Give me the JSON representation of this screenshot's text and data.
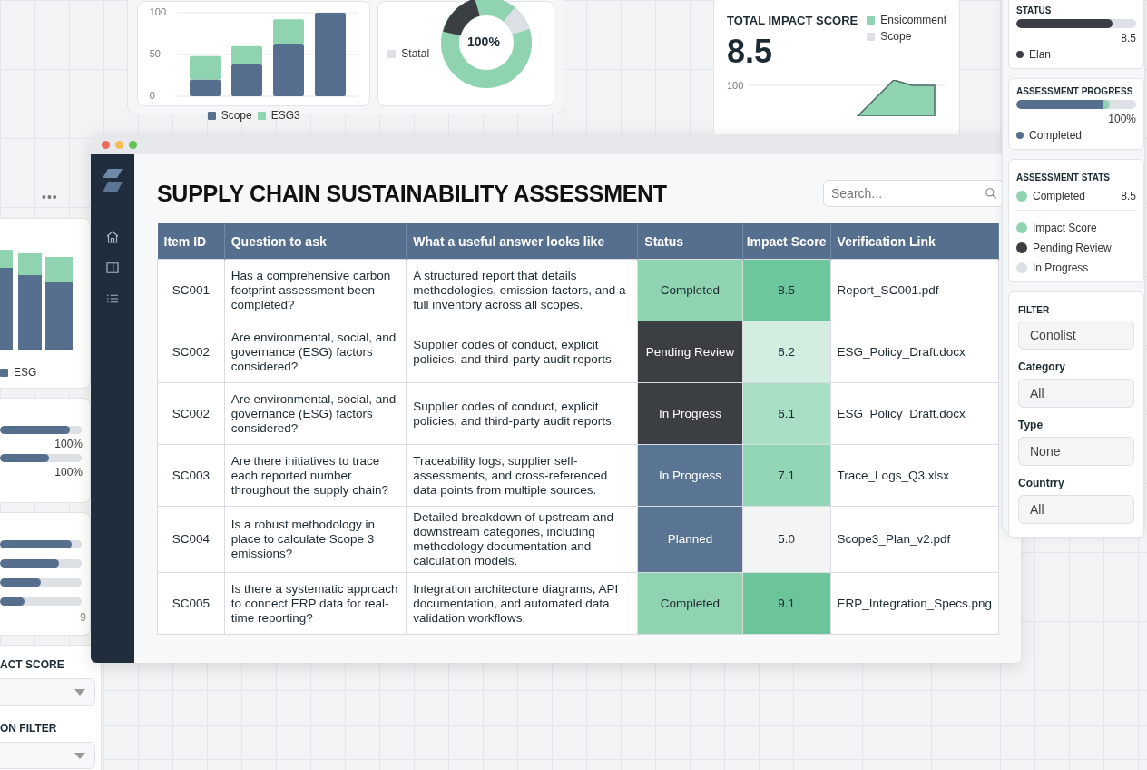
{
  "background": {
    "top_chart_card": {
      "chart_data": {
        "type": "bar",
        "stacked": true,
        "yticks": [
          0,
          50,
          100
        ],
        "ylim": [
          0,
          100
        ],
        "series": [
          {
            "name": "Scope",
            "color": "#566f8f",
            "values": [
              20,
              38,
              62,
              100
            ]
          },
          {
            "name": "ESG3",
            "color": "#8fd3b0",
            "values": [
              28,
              22,
              30,
              0
            ]
          }
        ]
      }
    },
    "donut_card": {
      "center_label": "100%",
      "legend": [
        {
          "label": "Statal",
          "color": "#dcdfe3"
        }
      ]
    },
    "impact_card": {
      "title": "TOTAL IMPACT SCORE",
      "value": "8.5",
      "axis_label": "100",
      "legend": [
        {
          "label": "Ensicomment",
          "color": "#8fd3b0"
        },
        {
          "label": "Scope",
          "color": "#dde1e6"
        }
      ]
    },
    "left_panel": {
      "menu": "•••",
      "chart_legend": "ESG",
      "progress": [
        {
          "level": 0.85,
          "reading": "100%"
        },
        {
          "level": 0.6,
          "reading": "100%"
        }
      ],
      "bars": [
        {
          "level": 0.88
        },
        {
          "level": 0.72
        },
        {
          "level": 0.5
        },
        {
          "level": 0.3
        }
      ],
      "bars_note": "9",
      "dropdowns": [
        {
          "label": "ACT SCORE"
        },
        {
          "label": "ON FILTER"
        }
      ]
    },
    "right_panel": {
      "status": {
        "title": "STATUS",
        "level": 0.8,
        "reading": "8.5",
        "legend": {
          "label": "Elan",
          "color": "#3b3f43"
        }
      },
      "progress": {
        "title": "ASSESSMENT PROGRESS",
        "level": 0.78,
        "reading": "100%",
        "legend": {
          "label": "Completed",
          "color": "#566f8f"
        }
      },
      "stats": {
        "title": "ASSESSMENT STATS",
        "reading": "8.5",
        "items": [
          {
            "label": "Completed",
            "color": "#8fd3b0"
          },
          {
            "label": "Impact Score",
            "color": "#8fd3b0"
          },
          {
            "label": "Pending Review",
            "color": "#3b3f43"
          },
          {
            "label": "In Progress",
            "color": "#dcdfe3"
          }
        ]
      },
      "filter": {
        "title": "FILTER",
        "fields": [
          {
            "value": "Conolist"
          },
          {
            "label": "Category",
            "value": "All"
          },
          {
            "label": "Type",
            "value": "None"
          },
          {
            "label": "Countrry",
            "value": "All"
          }
        ]
      }
    }
  },
  "window": {
    "title": "SUPPLY CHAIN SUSTAINABILITY ASSESSMENT",
    "search": {
      "placeholder": "Search..."
    },
    "table": {
      "columns": [
        "Item ID",
        "Question to ask",
        "What a useful answer looks like",
        "Status",
        "Impact Score",
        "Verification Link"
      ],
      "rows": [
        {
          "id": "SC001",
          "question": "Has a comprehensive carbon footprint assessment been completed?",
          "answer": "A structured report that details methodologies, emission factors, and a full inventory across all scopes.",
          "status": {
            "text": "Completed",
            "color": "#8fd3b0"
          },
          "impact": {
            "text": "8.5",
            "color": "#6cc79c"
          },
          "link": "Report_SC001.pdf"
        },
        {
          "id": "SC002",
          "question": "Are environmental, social, and governance (ESG) factors considered?",
          "answer": "Supplier codes of conduct, explicit policies, and third-party audit reports.",
          "status": {
            "text": "Pending Review",
            "color": "#3b3f43"
          },
          "impact": {
            "text": "6.2",
            "color": "#d3eee0"
          },
          "link": "ESG_Policy_Draft.docx"
        },
        {
          "id": "SC002",
          "question": "Are environmental, social, and governance (ESG) factors considered?",
          "answer": "Supplier codes of conduct, explicit policies, and third-party audit reports.",
          "status": {
            "text": "In Progress",
            "color": "#3b3f43"
          },
          "impact": {
            "text": "6.1",
            "color": "#a9dfc4"
          },
          "link": "ESG_Policy_Draft.docx"
        },
        {
          "id": "SC003",
          "question": "Are there initiatives to trace each reported number throughout the supply chain?",
          "answer": "Traceability logs, supplier self-assessments, and cross-referenced data points from multiple sources.",
          "status": {
            "text": "In Progress",
            "color": "#5a7594"
          },
          "impact": {
            "text": "7.1",
            "color": "#93d6b5"
          },
          "link": "Trace_Logs_Q3.xlsx"
        },
        {
          "id": "SC004",
          "question": "Is a robust methodology in place to calculate Scope 3 emissions?",
          "answer": "Detailed breakdown of upstream and downstream categories, including methodology documentation and calculation models.",
          "status": {
            "text": "Planned",
            "color": "#5a7594"
          },
          "impact": {
            "text": "5.0",
            "color": "#f2f5f4"
          },
          "link": "Scope3_Plan_v2.pdf"
        },
        {
          "id": "SC005",
          "question": "Is there a systematic approach to connect ERP data for real-time reporting?",
          "answer": "Integration architecture diagrams, API documentation, and automated data validation workflows.",
          "status": {
            "text": "Completed",
            "color": "#8fd3b0"
          },
          "impact": {
            "text": "9.1",
            "color": "#6cc49a"
          },
          "link": "ERP_Integration_Specs.png"
        }
      ]
    }
  }
}
